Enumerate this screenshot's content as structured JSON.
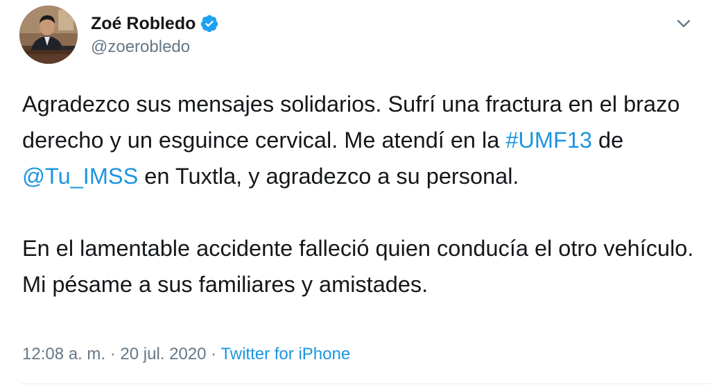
{
  "author": {
    "name": "Zoé Robledo",
    "handle": "@zoerobledo",
    "verified": true,
    "verified_icon": "verified-badge-icon",
    "avatar_icon": "profile-photo"
  },
  "tweet": {
    "paragraph1": {
      "text_a": "Agradezco sus mensajes solidarios. Sufrí una fractura en el brazo derecho y un esguince cervical. Me atendí en la ",
      "hashtag": "#UMF13",
      "text_b": " de ",
      "mention": "@Tu_IMSS",
      "text_c": " en Tuxtla, y agradezco a su personal."
    },
    "paragraph2": "En el lamentable accidente falleció quien conducía el otro vehículo. Mi pésame a sus familiares y amistades."
  },
  "meta": {
    "time": "12:08 a. m.",
    "separator1": " · ",
    "date": "20 jul. 2020",
    "separator2": " · ",
    "source": "Twitter for iPhone"
  },
  "menu": {
    "caret_icon": "chevron-down-icon"
  },
  "colors": {
    "link": "#1b95e0",
    "secondary_text": "#657786",
    "primary_text": "#14171a",
    "verified": "#1da1f2"
  }
}
